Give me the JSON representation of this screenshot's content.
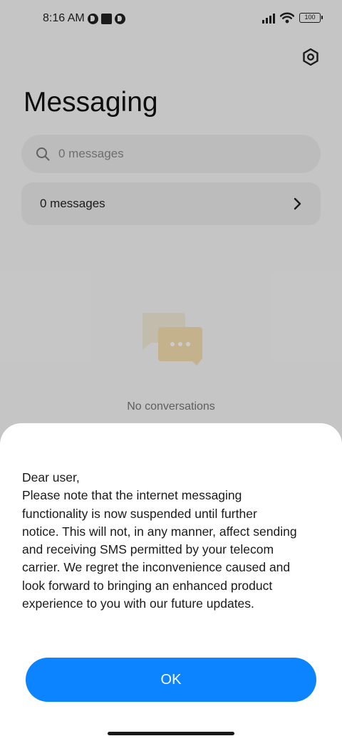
{
  "status_bar": {
    "time": "8:16 AM",
    "battery": "100",
    "icons": [
      "notification-round-icon",
      "notification-square-icon",
      "notification-round-icon",
      "signal-icon",
      "wifi-icon",
      "battery-icon"
    ]
  },
  "header": {
    "title": "Messaging",
    "settings_icon": "gear-icon"
  },
  "search": {
    "placeholder": "0 messages",
    "icon": "search-icon"
  },
  "messages_row": {
    "label": "0 messages",
    "icon": "chevron-right-icon"
  },
  "empty_state": {
    "icon": "chat-bubbles-icon",
    "text": "No conversations"
  },
  "dialog": {
    "lines": [
      "Dear user,",
      "Please note that the internet messaging",
      "functionality is now suspended until further",
      "notice. This will not, in any manner, affect sending",
      "and receiving SMS permitted by your telecom",
      "carrier. We regret the inconvenience caused and",
      "look forward to bringing an enhanced product",
      "experience to you with our future updates."
    ],
    "ok_label": "OK"
  },
  "colors": {
    "accent": "#0d84ff",
    "background": "#f7f7f7",
    "card": "#ececec"
  }
}
